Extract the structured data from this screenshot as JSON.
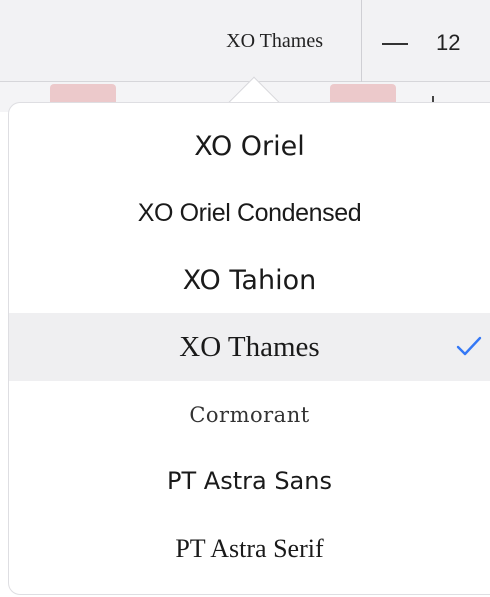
{
  "toolbar": {
    "current_font": "XO Thames",
    "size_value": "12",
    "minus_icon": "minus-icon"
  },
  "font_menu": {
    "options": [
      {
        "label": "XO Oriel",
        "selected": false
      },
      {
        "label": "XO Oriel Condensed",
        "selected": false
      },
      {
        "label": "XO Tahion",
        "selected": false
      },
      {
        "label": "XO Thames",
        "selected": true
      },
      {
        "label": "Cormorant",
        "selected": false
      },
      {
        "label": "PT Astra Sans",
        "selected": false
      },
      {
        "label": "PT Astra Serif",
        "selected": false
      }
    ],
    "check_icon": "checkmark-icon",
    "check_color": "#3478f6",
    "selected_background": "#efeff1"
  },
  "colors": {
    "swatch": "#ecc9cb",
    "toolbar_background": "#f2f2f4"
  }
}
